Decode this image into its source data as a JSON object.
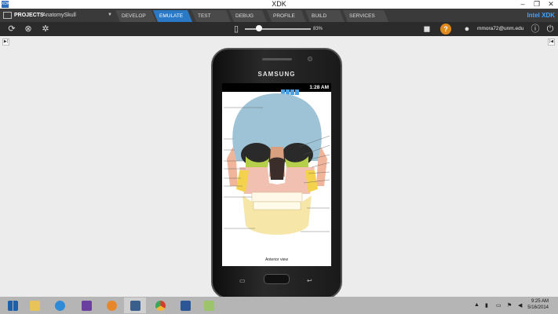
{
  "window": {
    "title": "XDK",
    "app_icon_text": "XDK"
  },
  "nav": {
    "projects_label": "PROJECTS",
    "project_name": "AnatomySkull",
    "tabs": [
      {
        "label": "DEVELOP",
        "active": false
      },
      {
        "label": "EMULATE",
        "active": true
      },
      {
        "label": "TEST",
        "active": false
      },
      {
        "label": "DEBUG",
        "active": false
      },
      {
        "label": "PROFILE",
        "active": false
      },
      {
        "label": "BUILD",
        "active": false
      },
      {
        "label": "SERVICES",
        "active": false
      }
    ],
    "brand": "Intel XDK"
  },
  "toolbar": {
    "zoom_label": "83%",
    "zoom_level": 0.83,
    "user_email": "mmora72@unm.edu"
  },
  "device": {
    "brand": "SAMSUNG",
    "status_time": "1:28 AM",
    "caption": "Anterior view"
  },
  "taskbar": {
    "time": "9:25 AM",
    "date": "5/16/2014"
  },
  "colors": {
    "tab_active": "#2a79c6",
    "navbar": "#3a3a3a",
    "toolbar": "#2b2b2b",
    "help": "#e08a1e"
  }
}
